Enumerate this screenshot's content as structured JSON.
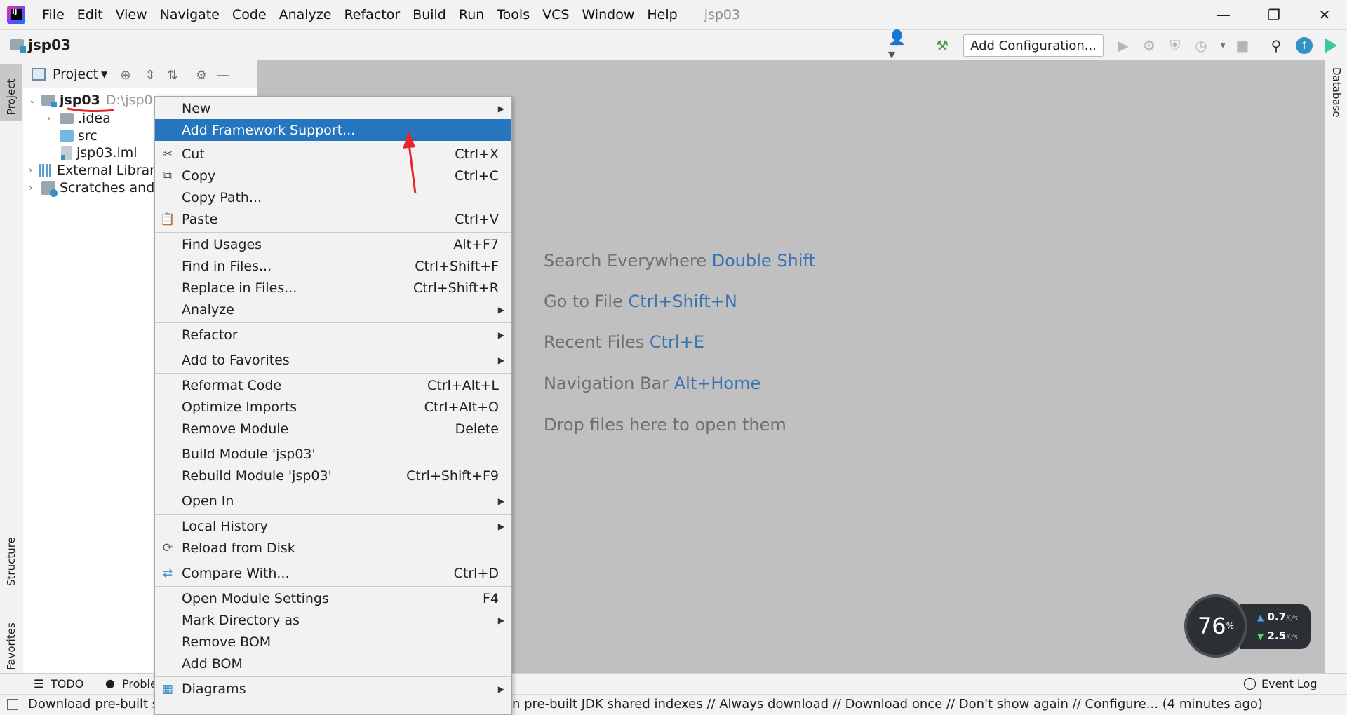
{
  "menubar": {
    "items": [
      "File",
      "Edit",
      "View",
      "Navigate",
      "Code",
      "Analyze",
      "Refactor",
      "Build",
      "Run",
      "Tools",
      "VCS",
      "Window",
      "Help"
    ],
    "project_name": "jsp03"
  },
  "navbar": {
    "project": "jsp03",
    "run_config": "Add Configuration..."
  },
  "left_strip": {
    "project_tab": "Project",
    "structure_tab": "Structure",
    "favorites_tab": "Favorites"
  },
  "right_strip": {
    "database_tab": "Database"
  },
  "project_panel": {
    "header": "Project",
    "tree": [
      {
        "label": "jsp03",
        "path": "D:\\jsp0"
      },
      {
        "label": ".idea"
      },
      {
        "label": "src"
      },
      {
        "label": "jsp03.iml"
      },
      {
        "label": "External Librar"
      },
      {
        "label": "Scratches and"
      }
    ]
  },
  "context_menu": {
    "items": [
      {
        "label": "New",
        "shortcut": "",
        "submenu": true
      },
      {
        "label": "Add Framework Support...",
        "shortcut": "",
        "selected": true
      },
      {
        "label": "Cut",
        "shortcut": "Ctrl+X",
        "icon": "scissors-icon"
      },
      {
        "label": "Copy",
        "shortcut": "Ctrl+C",
        "icon": "copy-icon"
      },
      {
        "label": "Copy Path...",
        "shortcut": ""
      },
      {
        "label": "Paste",
        "shortcut": "Ctrl+V",
        "icon": "clipboard-icon"
      },
      {
        "label": "Find Usages",
        "shortcut": "Alt+F7"
      },
      {
        "label": "Find in Files...",
        "shortcut": "Ctrl+Shift+F"
      },
      {
        "label": "Replace in Files...",
        "shortcut": "Ctrl+Shift+R"
      },
      {
        "label": "Analyze",
        "shortcut": "",
        "submenu": true
      },
      {
        "label": "Refactor",
        "shortcut": "",
        "submenu": true
      },
      {
        "label": "Add to Favorites",
        "shortcut": "",
        "submenu": true
      },
      {
        "label": "Reformat Code",
        "shortcut": "Ctrl+Alt+L"
      },
      {
        "label": "Optimize Imports",
        "shortcut": "Ctrl+Alt+O"
      },
      {
        "label": "Remove Module",
        "shortcut": "Delete"
      },
      {
        "label": "Build Module 'jsp03'",
        "shortcut": ""
      },
      {
        "label": "Rebuild Module 'jsp03'",
        "shortcut": "Ctrl+Shift+F9"
      },
      {
        "label": "Open In",
        "shortcut": "",
        "submenu": true
      },
      {
        "label": "Local History",
        "shortcut": "",
        "submenu": true
      },
      {
        "label": "Reload from Disk",
        "shortcut": "",
        "icon": "reload-icon"
      },
      {
        "label": "Compare With...",
        "shortcut": "Ctrl+D",
        "icon": "compare-icon"
      },
      {
        "label": "Open Module Settings",
        "shortcut": "F4"
      },
      {
        "label": "Mark Directory as",
        "shortcut": "",
        "submenu": true
      },
      {
        "label": "Remove BOM",
        "shortcut": ""
      },
      {
        "label": "Add BOM",
        "shortcut": ""
      },
      {
        "label": "Diagrams",
        "shortcut": "",
        "submenu": true,
        "icon": "diagram-icon"
      }
    ]
  },
  "editor_hints": [
    {
      "text": "Search Everywhere",
      "key": "Double Shift"
    },
    {
      "text": "Go to File",
      "key": "Ctrl+Shift+N"
    },
    {
      "text": "Recent Files",
      "key": "Ctrl+E"
    },
    {
      "text": "Navigation Bar",
      "key": "Alt+Home"
    },
    {
      "text": "Drop files here to open them",
      "key": ""
    }
  ],
  "bottom_tools": {
    "todo": "TODO",
    "problems": "Proble",
    "event_log": "Event Log"
  },
  "status_bar": {
    "text_left": "Download pre-built s",
    "text_right": "n pre-built JDK shared indexes // Always download // Download once // Don't show again // Configure... (4 minutes ago)"
  },
  "net_monitor": {
    "percent": "76",
    "percent_unit": "%",
    "up": "0.7",
    "up_unit": "K/s",
    "down": "2.5",
    "down_unit": "K/s"
  },
  "colors": {
    "selection": "#2675bf",
    "hint_key": "#3b73b2",
    "editor_bg": "#c0c0c0",
    "annotation_red": "#e8262a"
  }
}
